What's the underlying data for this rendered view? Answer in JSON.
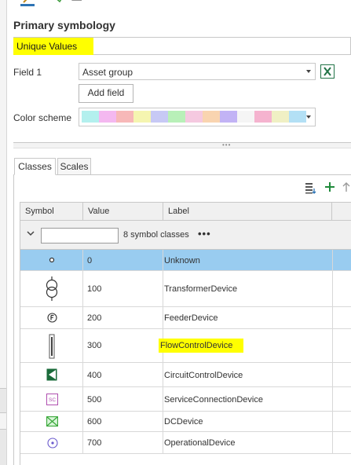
{
  "primary_symbology": {
    "title": "Primary symbology",
    "renderer": "Unique Values"
  },
  "field1": {
    "label": "Field 1",
    "value": "Asset group"
  },
  "add_field_label": "Add field",
  "color_scheme": {
    "label": "Color scheme",
    "swatches": [
      "#b3f0ee",
      "#f4b8f0",
      "#f7b8b8",
      "#f5f5b0",
      "#c7c9f5",
      "#b8f0b8",
      "#f5c9e0",
      "#f9d4b0",
      "#c2b3f5",
      "#f5f5f5",
      "#f5b3cf",
      "#f0f0c4",
      "#b3e0f5"
    ]
  },
  "tabs": {
    "classes": "Classes",
    "scales": "Scales"
  },
  "grid": {
    "columns": {
      "symbol": "Symbol",
      "value": "Value",
      "label": "Label"
    },
    "group_heading_value": "",
    "group_count": "8 symbol classes",
    "more_glyph": "•••",
    "rows": [
      {
        "value": "0",
        "label": "Unknown",
        "symbol": "small-circle-icon"
      },
      {
        "value": "100",
        "label": "TransformerDevice",
        "symbol": "transformer-icon"
      },
      {
        "value": "200",
        "label": "FeederDevice",
        "symbol": "feeder-f-icon"
      },
      {
        "value": "300",
        "label": "FlowControlDevice",
        "symbol": "flow-control-bar-icon"
      },
      {
        "value": "400",
        "label": "CircuitControlDevice",
        "symbol": "circuit-triangle-icon"
      },
      {
        "value": "500",
        "label": "ServiceConnectionDevice",
        "symbol": "sc-box-icon"
      },
      {
        "value": "600",
        "label": "DCDevice",
        "symbol": "dc-crossed-box-icon"
      },
      {
        "value": "700",
        "label": "OperationalDevice",
        "symbol": "operational-circle-icon"
      }
    ]
  },
  "colors": {
    "accent": "#2e74b5",
    "selected_row": "#99ccf0",
    "highlight": "#ffff00",
    "green_icon": "#1f8a3b"
  }
}
